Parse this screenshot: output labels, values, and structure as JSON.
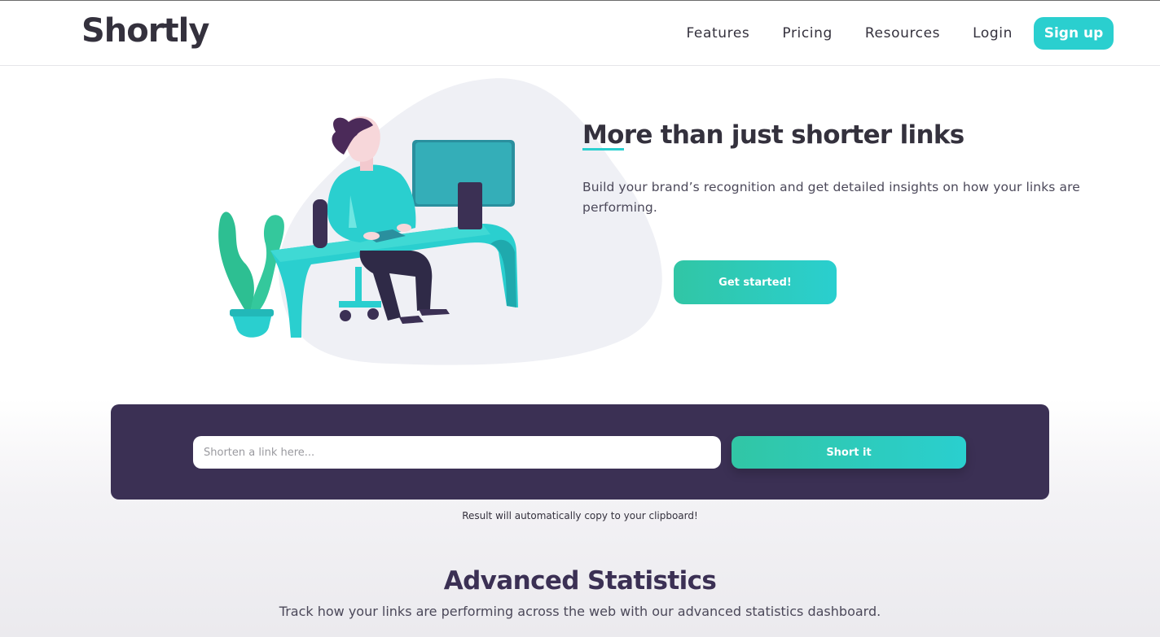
{
  "header": {
    "logo": "Shortly",
    "nav": [
      "Features",
      "Pricing",
      "Resources",
      "Login"
    ],
    "signup_label": "Sign up"
  },
  "hero": {
    "title": "More than just shorter links",
    "description": "Build your brand’s recognition and get detailed insights on how your links are performing.",
    "cta_label": "Get started!"
  },
  "shortener": {
    "placeholder": "Shorten a link here...",
    "value": "",
    "button_label": "Short it",
    "note": "Result will automatically copy to your clipboard!"
  },
  "statistics": {
    "title": "Advanced Statistics",
    "description": "Track how your links are performing across the web with our advanced statistics dashboard."
  },
  "colors": {
    "accent": "#2acfcf",
    "dark_violet": "#3b3054",
    "text_dark": "#34313d"
  }
}
